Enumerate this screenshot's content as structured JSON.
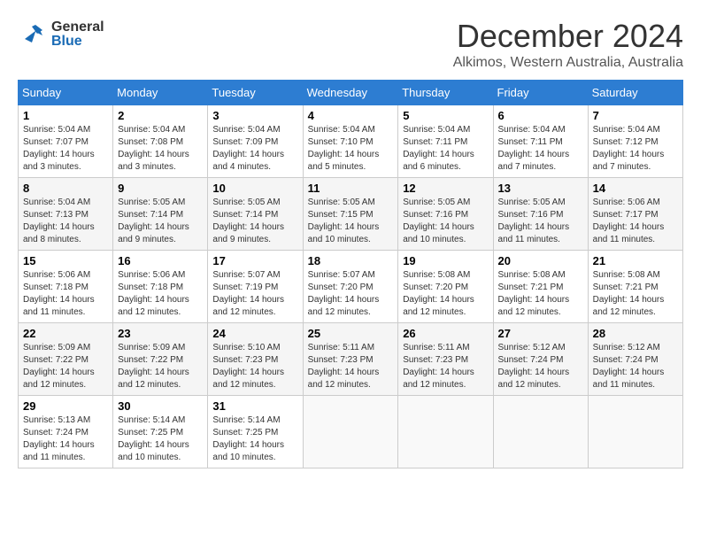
{
  "header": {
    "logo": {
      "general": "General",
      "blue": "Blue"
    },
    "title": "December 2024",
    "location": "Alkimos, Western Australia, Australia"
  },
  "weekdays": [
    "Sunday",
    "Monday",
    "Tuesday",
    "Wednesday",
    "Thursday",
    "Friday",
    "Saturday"
  ],
  "weeks": [
    [
      {
        "day": "1",
        "sunrise": "5:04 AM",
        "sunset": "7:07 PM",
        "daylight": "14 hours and 3 minutes."
      },
      {
        "day": "2",
        "sunrise": "5:04 AM",
        "sunset": "7:08 PM",
        "daylight": "14 hours and 3 minutes."
      },
      {
        "day": "3",
        "sunrise": "5:04 AM",
        "sunset": "7:09 PM",
        "daylight": "14 hours and 4 minutes."
      },
      {
        "day": "4",
        "sunrise": "5:04 AM",
        "sunset": "7:10 PM",
        "daylight": "14 hours and 5 minutes."
      },
      {
        "day": "5",
        "sunrise": "5:04 AM",
        "sunset": "7:11 PM",
        "daylight": "14 hours and 6 minutes."
      },
      {
        "day": "6",
        "sunrise": "5:04 AM",
        "sunset": "7:11 PM",
        "daylight": "14 hours and 7 minutes."
      },
      {
        "day": "7",
        "sunrise": "5:04 AM",
        "sunset": "7:12 PM",
        "daylight": "14 hours and 7 minutes."
      }
    ],
    [
      {
        "day": "8",
        "sunrise": "5:04 AM",
        "sunset": "7:13 PM",
        "daylight": "14 hours and 8 minutes."
      },
      {
        "day": "9",
        "sunrise": "5:05 AM",
        "sunset": "7:14 PM",
        "daylight": "14 hours and 9 minutes."
      },
      {
        "day": "10",
        "sunrise": "5:05 AM",
        "sunset": "7:14 PM",
        "daylight": "14 hours and 9 minutes."
      },
      {
        "day": "11",
        "sunrise": "5:05 AM",
        "sunset": "7:15 PM",
        "daylight": "14 hours and 10 minutes."
      },
      {
        "day": "12",
        "sunrise": "5:05 AM",
        "sunset": "7:16 PM",
        "daylight": "14 hours and 10 minutes."
      },
      {
        "day": "13",
        "sunrise": "5:05 AM",
        "sunset": "7:16 PM",
        "daylight": "14 hours and 11 minutes."
      },
      {
        "day": "14",
        "sunrise": "5:06 AM",
        "sunset": "7:17 PM",
        "daylight": "14 hours and 11 minutes."
      }
    ],
    [
      {
        "day": "15",
        "sunrise": "5:06 AM",
        "sunset": "7:18 PM",
        "daylight": "14 hours and 11 minutes."
      },
      {
        "day": "16",
        "sunrise": "5:06 AM",
        "sunset": "7:18 PM",
        "daylight": "14 hours and 12 minutes."
      },
      {
        "day": "17",
        "sunrise": "5:07 AM",
        "sunset": "7:19 PM",
        "daylight": "14 hours and 12 minutes."
      },
      {
        "day": "18",
        "sunrise": "5:07 AM",
        "sunset": "7:20 PM",
        "daylight": "14 hours and 12 minutes."
      },
      {
        "day": "19",
        "sunrise": "5:08 AM",
        "sunset": "7:20 PM",
        "daylight": "14 hours and 12 minutes."
      },
      {
        "day": "20",
        "sunrise": "5:08 AM",
        "sunset": "7:21 PM",
        "daylight": "14 hours and 12 minutes."
      },
      {
        "day": "21",
        "sunrise": "5:08 AM",
        "sunset": "7:21 PM",
        "daylight": "14 hours and 12 minutes."
      }
    ],
    [
      {
        "day": "22",
        "sunrise": "5:09 AM",
        "sunset": "7:22 PM",
        "daylight": "14 hours and 12 minutes."
      },
      {
        "day": "23",
        "sunrise": "5:09 AM",
        "sunset": "7:22 PM",
        "daylight": "14 hours and 12 minutes."
      },
      {
        "day": "24",
        "sunrise": "5:10 AM",
        "sunset": "7:23 PM",
        "daylight": "14 hours and 12 minutes."
      },
      {
        "day": "25",
        "sunrise": "5:11 AM",
        "sunset": "7:23 PM",
        "daylight": "14 hours and 12 minutes."
      },
      {
        "day": "26",
        "sunrise": "5:11 AM",
        "sunset": "7:23 PM",
        "daylight": "14 hours and 12 minutes."
      },
      {
        "day": "27",
        "sunrise": "5:12 AM",
        "sunset": "7:24 PM",
        "daylight": "14 hours and 12 minutes."
      },
      {
        "day": "28",
        "sunrise": "5:12 AM",
        "sunset": "7:24 PM",
        "daylight": "14 hours and 11 minutes."
      }
    ],
    [
      {
        "day": "29",
        "sunrise": "5:13 AM",
        "sunset": "7:24 PM",
        "daylight": "14 hours and 11 minutes."
      },
      {
        "day": "30",
        "sunrise": "5:14 AM",
        "sunset": "7:25 PM",
        "daylight": "14 hours and 10 minutes."
      },
      {
        "day": "31",
        "sunrise": "5:14 AM",
        "sunset": "7:25 PM",
        "daylight": "14 hours and 10 minutes."
      },
      null,
      null,
      null,
      null
    ]
  ],
  "labels": {
    "sunrise": "Sunrise:",
    "sunset": "Sunset:",
    "daylight": "Daylight:"
  }
}
